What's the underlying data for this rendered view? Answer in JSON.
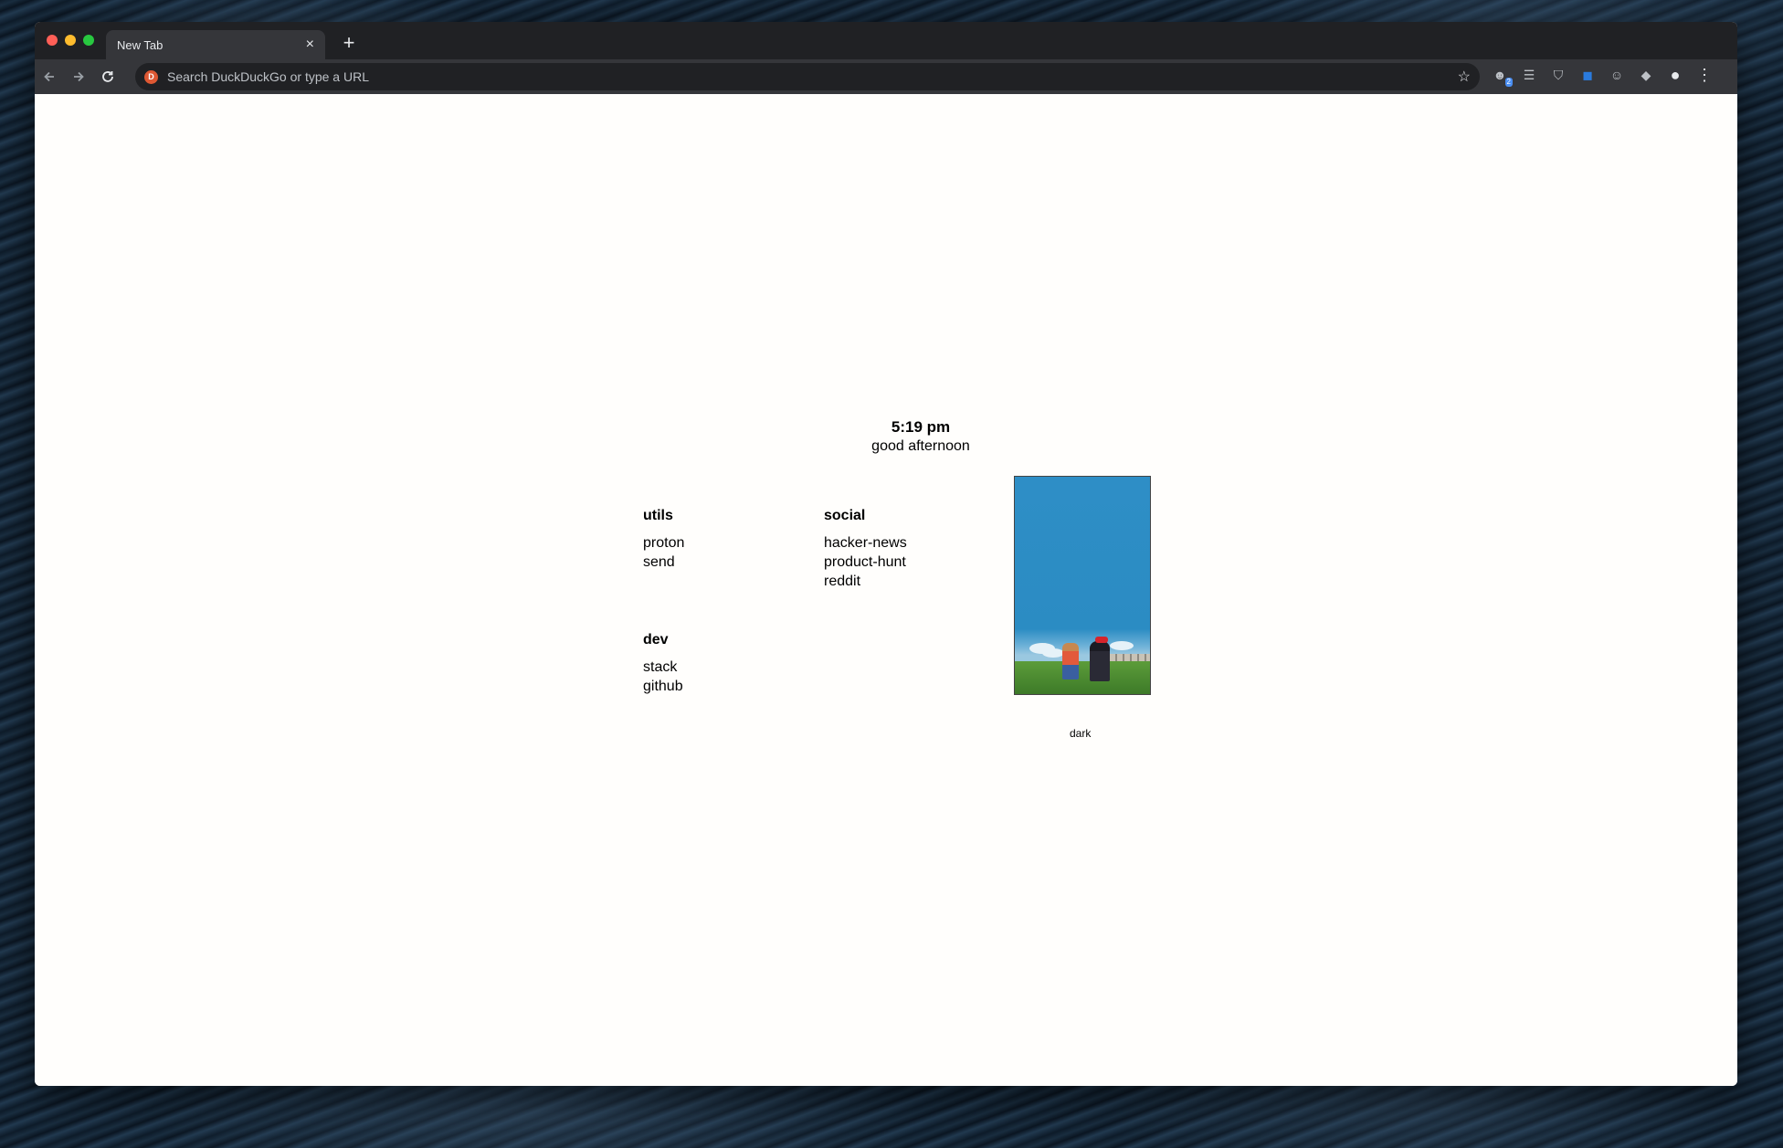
{
  "browser": {
    "tab_title": "New Tab",
    "tab_close": "×",
    "new_tab": "+",
    "omnibox_placeholder": "Search DuckDuckGo or type a URL",
    "search_engine_icon": "D"
  },
  "page": {
    "time": "5:19 pm",
    "greeting": "good afternoon",
    "groups": {
      "utils": {
        "title": "utils",
        "links": [
          "proton",
          "send"
        ]
      },
      "social": {
        "title": "social",
        "links": [
          "hacker-news",
          "product-hunt",
          "reddit"
        ]
      },
      "dev": {
        "title": "dev",
        "links": [
          "stack",
          "github"
        ]
      }
    },
    "theme_toggle": "dark"
  },
  "extensions": {
    "badge_count": "2"
  },
  "colors": {
    "titlebar": "#202124",
    "toolbar": "#35363a",
    "page_bg": "#fffefc",
    "art_sky": "#2e8ec6"
  }
}
